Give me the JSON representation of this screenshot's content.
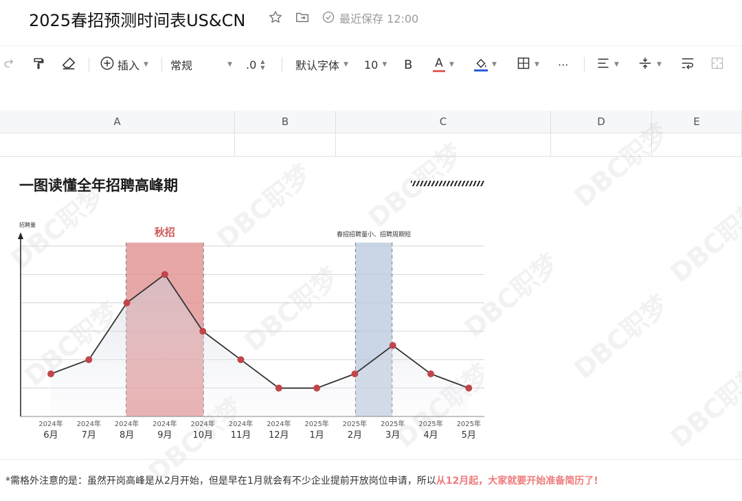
{
  "app": {
    "doc_title": "2025春招预测时间表US&CN",
    "save_status": "最近保存 12:00"
  },
  "toolbar": {
    "insert_label": "插入",
    "format_label": "常规",
    "decimal_label": ".0",
    "font_label": "默认字体",
    "font_size": "10",
    "bold_label": "B",
    "font_color_label": "A",
    "more_label": "···",
    "font_color": "#e06060",
    "fill_color": "#2a5bd7"
  },
  "columns": [
    "A",
    "B",
    "C",
    "D",
    "E"
  ],
  "card": {
    "title": "一图读懂全年招聘高峰期"
  },
  "chart_data": {
    "type": "line",
    "ylabel": "招聘量",
    "categories_year": [
      "2024年",
      "2024年",
      "2024年",
      "2024年",
      "2024年",
      "2024年",
      "2024年",
      "2025年",
      "2025年",
      "2025年",
      "2025年",
      "2025年"
    ],
    "categories_month": [
      "6月",
      "7月",
      "8月",
      "9月",
      "10月",
      "11月",
      "12月",
      "1月",
      "2月",
      "3月",
      "4月",
      "5月"
    ],
    "series": [
      {
        "values": [
          3,
          4,
          8,
          10,
          6,
          4,
          2,
          2,
          3,
          5,
          3,
          2
        ]
      }
    ],
    "ylim": [
      0,
      12
    ],
    "grid": true,
    "highlight_autumn": {
      "label": "秋招",
      "from_index": 2,
      "to_index": 4,
      "color": "#e08a8a"
    },
    "highlight_spring": {
      "label": "春招招聘量小、招聘周期短",
      "from_index": 8,
      "to_index": 9,
      "color": "#b8c8dc"
    },
    "line_color": "#333333",
    "marker_color": "#c0464a"
  },
  "note": {
    "prefix": "*需格外注意的是：虽然开岗高峰是从2月开始，但是早在1月就会有不少企业提前开放岗位申请，所以",
    "highlight": "从12月起，大家就要开始准备简历了!"
  },
  "watermark": "DBC职梦"
}
